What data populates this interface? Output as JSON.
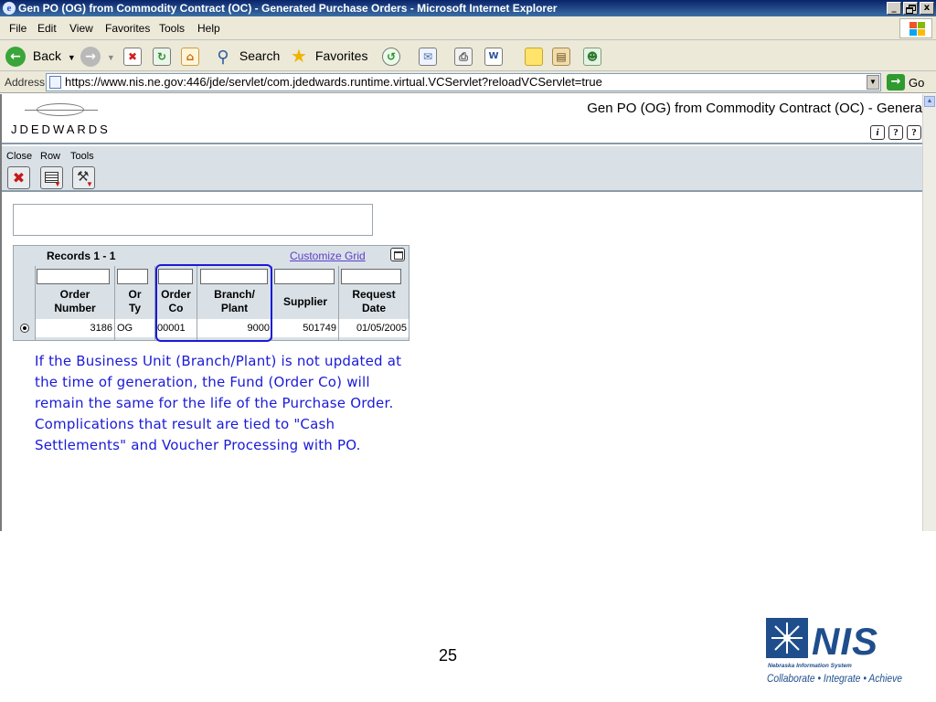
{
  "window": {
    "title": "Gen PO (OG) from Commodity Contract (OC) - Generated Purchase Orders - Microsoft Internet Explorer",
    "controls": [
      "_",
      " ",
      "x"
    ]
  },
  "menu": [
    "File",
    "Edit",
    "View",
    "Favorites",
    "Tools",
    "Help"
  ],
  "toolbar": {
    "back_label": "Back",
    "search_label": "Search",
    "favorites_label": "Favorites"
  },
  "address": {
    "label": "Address",
    "url": "https://www.nis.ne.gov:446/jde/servlet/com.jdedwards.runtime.virtual.VCServlet?reloadVCServlet=true",
    "go_label": "Go"
  },
  "jde": {
    "logo_text": "JDEDWARDS",
    "form_title": "Gen PO (OG) from Commodity Contract (OC) - Genera",
    "help_buttons": [
      "i",
      "?",
      "?"
    ]
  },
  "form_bar": {
    "labels": [
      "Close",
      "Row",
      "Tools"
    ]
  },
  "grid": {
    "records_label": "Records 1 - 1",
    "customize_label": "Customize Grid",
    "columns": [
      {
        "line1": "Order",
        "line2": "Number"
      },
      {
        "line1": "Or",
        "line2": "Ty"
      },
      {
        "line1": "Order",
        "line2": "Co"
      },
      {
        "line1": "Branch/",
        "line2": "Plant"
      },
      {
        "line1": "Supplier",
        "line2": ""
      },
      {
        "line1": "Request",
        "line2": "Date"
      }
    ],
    "rows": [
      {
        "order_number": "3186",
        "or_ty": "OG",
        "order_co": "00001",
        "branch_plant": "9000",
        "supplier": "501749",
        "request_date": "01/05/2005"
      }
    ]
  },
  "annotation": {
    "lines": [
      "If the Business Unit (Branch/Plant) is not updated at",
      "the time of generation, the Fund (Order Co) will",
      "remain the same for the life of the Purchase Order.",
      "Complications that result are tied to \"Cash",
      "Settlements\" and Voucher Processing with PO."
    ],
    "color": "#1a1ad8"
  },
  "slide": {
    "number": "25"
  },
  "nis_logo": {
    "letters": "NIS",
    "subtitle": "Nebraska Information System",
    "tagline": "Collaborate • Integrate • Achieve",
    "color": "#1f4e8c"
  }
}
